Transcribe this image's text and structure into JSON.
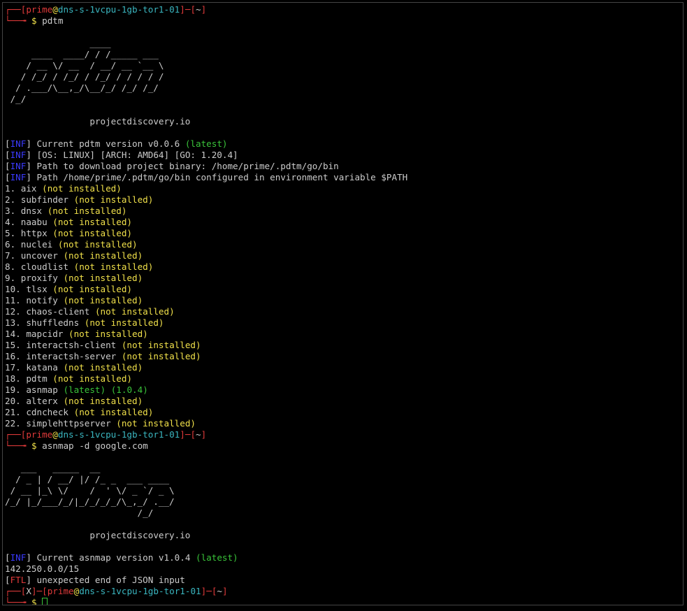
{
  "prompt": {
    "box_tl": "┌──",
    "box_bl": "└──╼",
    "user": "prime",
    "at": "@",
    "host": "dns-s-1vcpu-1gb-tor1-01",
    "dash": "─",
    "cwd": "~",
    "dollar": "$",
    "error_mark": "X"
  },
  "commands": [
    "pdtm",
    "asnmap -d google.com"
  ],
  "banners": {
    "pdtm": [
      "                ____",
      "     ____  ____/ / /_____ ___",
      "    / __ \\/ __  / __/ __ `__ \\",
      "   / /_/ / /_/ / /_/ / / / / /",
      "  / .___/\\__,_/\\__/_/ /_/ /_/",
      " /_/"
    ],
    "asnmap": [
      "   ___   _____  __",
      "  / _ | / __/ |/ /_ _  ___ ____",
      " / __ |_\\ \\/    /  ' \\/ _ `/ _ \\",
      "/_/ |_/___/_/|_/_/_/_/\\_,_/ .__/",
      "                         /_/"
    ],
    "site": "projectdiscovery.io"
  },
  "tags": {
    "inf": "INF",
    "ftl": "FTL"
  },
  "pdtm_info": {
    "version_prefix": "Current pdtm version v0.0.6 ",
    "version_status": "(latest)",
    "platform": "[OS: LINUX] [ARCH: AMD64] [GO: 1.20.4]",
    "download_path": "Path to download project binary: /home/prime/.pdtm/go/bin",
    "configured_path": "Path /home/prime/.pdtm/go/bin configured in environment variable $PATH"
  },
  "tools": [
    {
      "n": "1.",
      "name": "aix",
      "status": "(not installed)"
    },
    {
      "n": "2.",
      "name": "subfinder",
      "status": "(not installed)"
    },
    {
      "n": "3.",
      "name": "dnsx",
      "status": "(not installed)"
    },
    {
      "n": "4.",
      "name": "naabu",
      "status": "(not installed)"
    },
    {
      "n": "5.",
      "name": "httpx",
      "status": "(not installed)"
    },
    {
      "n": "6.",
      "name": "nuclei",
      "status": "(not installed)"
    },
    {
      "n": "7.",
      "name": "uncover",
      "status": "(not installed)"
    },
    {
      "n": "8.",
      "name": "cloudlist",
      "status": "(not installed)"
    },
    {
      "n": "9.",
      "name": "proxify",
      "status": "(not installed)"
    },
    {
      "n": "10.",
      "name": "tlsx",
      "status": "(not installed)"
    },
    {
      "n": "11.",
      "name": "notify",
      "status": "(not installed)"
    },
    {
      "n": "12.",
      "name": "chaos-client",
      "status": "(not installed)"
    },
    {
      "n": "13.",
      "name": "shuffledns",
      "status": "(not installed)"
    },
    {
      "n": "14.",
      "name": "mapcidr",
      "status": "(not installed)"
    },
    {
      "n": "15.",
      "name": "interactsh-client",
      "status": "(not installed)"
    },
    {
      "n": "16.",
      "name": "interactsh-server",
      "status": "(not installed)"
    },
    {
      "n": "17.",
      "name": "katana",
      "status": "(not installed)"
    },
    {
      "n": "18.",
      "name": "pdtm",
      "status": "(not installed)"
    },
    {
      "n": "19.",
      "name": "asnmap",
      "status": "(latest)",
      "version": "(1.0.4)"
    },
    {
      "n": "20.",
      "name": "alterx",
      "status": "(not installed)"
    },
    {
      "n": "21.",
      "name": "cdncheck",
      "status": "(not installed)"
    },
    {
      "n": "22.",
      "name": "simplehttpserver",
      "status": "(not installed)"
    }
  ],
  "asnmap_info": {
    "version_prefix": "Current asnmap version v1.0.4 ",
    "version_status": "(latest)",
    "result": "142.250.0.0/15",
    "error": "unexpected end of JSON input"
  },
  "colors": {
    "background": "#000000",
    "text": "#cccccc",
    "prompt_red": "#e03a3a",
    "host_cyan": "#3ab6c0",
    "tag_blue": "#3a3aff",
    "status_yellow": "#f0e04a",
    "latest_green": "#3ac43a"
  }
}
